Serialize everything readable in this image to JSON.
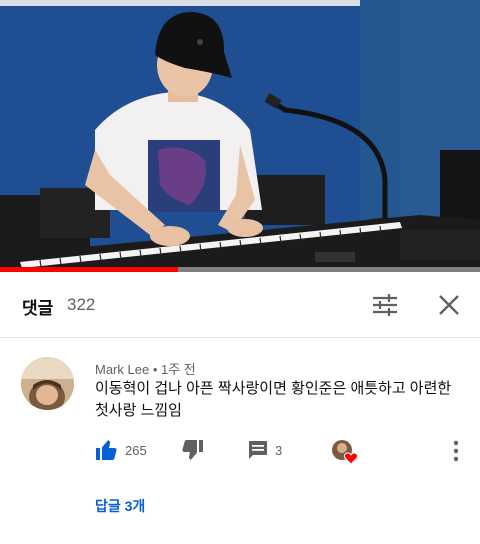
{
  "video": {
    "progress_fraction": 0.37,
    "colors": {
      "played": "#ff0000",
      "backdrop": "#1e4f93"
    }
  },
  "comments_header": {
    "title": "댓글",
    "count": "322",
    "filter_icon": "sort-sliders-icon",
    "close_icon": "close-icon"
  },
  "comment": {
    "author": "Mark Lee",
    "separator": " • ",
    "time": "1주 전",
    "text_line1": "이동혁이 겁나 아픈 짝사랑이면 황인준은 애틋하고 아련한",
    "text_line2": "첫사랑 느낌임",
    "like_count": "265",
    "reply_count": "3",
    "replies_link": "답글 3개",
    "icons": [
      "thumb-up-icon",
      "thumb-down-icon",
      "comment-icon",
      "creator-heart-icon",
      "more-vert-icon"
    ],
    "accent_color": "#065fd4"
  }
}
